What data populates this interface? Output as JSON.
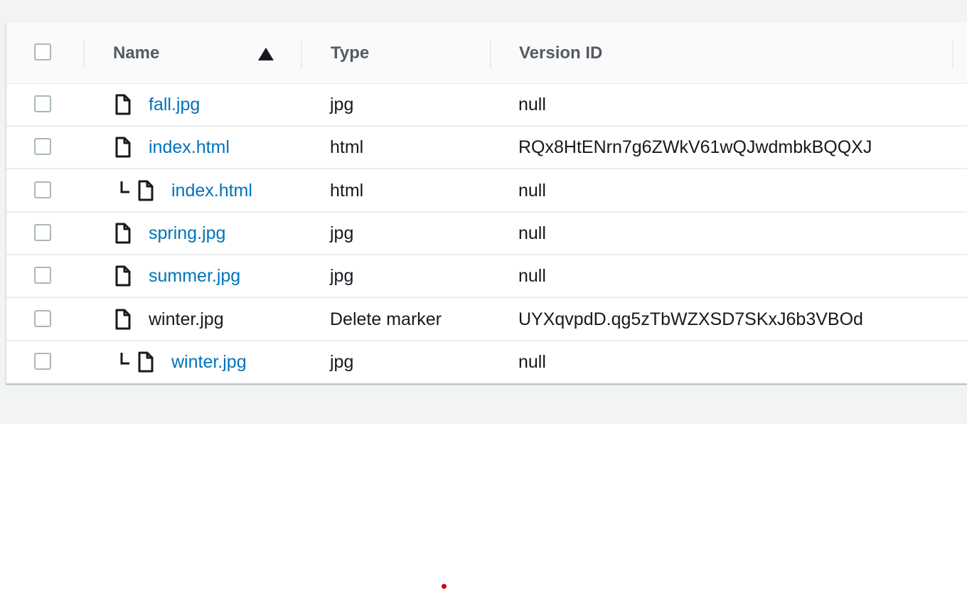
{
  "table": {
    "columns": {
      "name": "Name",
      "type": "Type",
      "version_id": "Version ID"
    },
    "sort": {
      "column": "name",
      "direction": "ascending",
      "icon": "sort-ascending-icon"
    },
    "rows": [
      {
        "name": "fall.jpg",
        "type": "jpg",
        "version_id": "null",
        "is_link": true,
        "nested": false,
        "icon": "file-icon"
      },
      {
        "name": "index.html",
        "type": "html",
        "version_id": "RQx8HtENrn7g6ZWkV61wQJwdmbkBQQXJ",
        "is_link": true,
        "nested": false,
        "icon": "file-icon"
      },
      {
        "name": "index.html",
        "type": "html",
        "version_id": "null",
        "is_link": true,
        "nested": true,
        "icon": "file-icon"
      },
      {
        "name": "spring.jpg",
        "type": "jpg",
        "version_id": "null",
        "is_link": true,
        "nested": false,
        "icon": "file-icon"
      },
      {
        "name": "summer.jpg",
        "type": "jpg",
        "version_id": "null",
        "is_link": true,
        "nested": false,
        "icon": "file-icon"
      },
      {
        "name": "winter.jpg",
        "type": "Delete marker",
        "version_id": "UYXqvpdD.qg5zTbWZXSD7SKxJ6b3VBOd",
        "is_link": false,
        "nested": false,
        "icon": "file-icon"
      },
      {
        "name": "winter.jpg",
        "type": "jpg",
        "version_id": "null",
        "is_link": true,
        "nested": true,
        "icon": "file-icon"
      }
    ]
  },
  "colors": {
    "link": "#0073bb",
    "text": "#16191f",
    "header_text": "#545b64",
    "background": "#f2f3f3",
    "cursor_dot": "#d0021b"
  }
}
